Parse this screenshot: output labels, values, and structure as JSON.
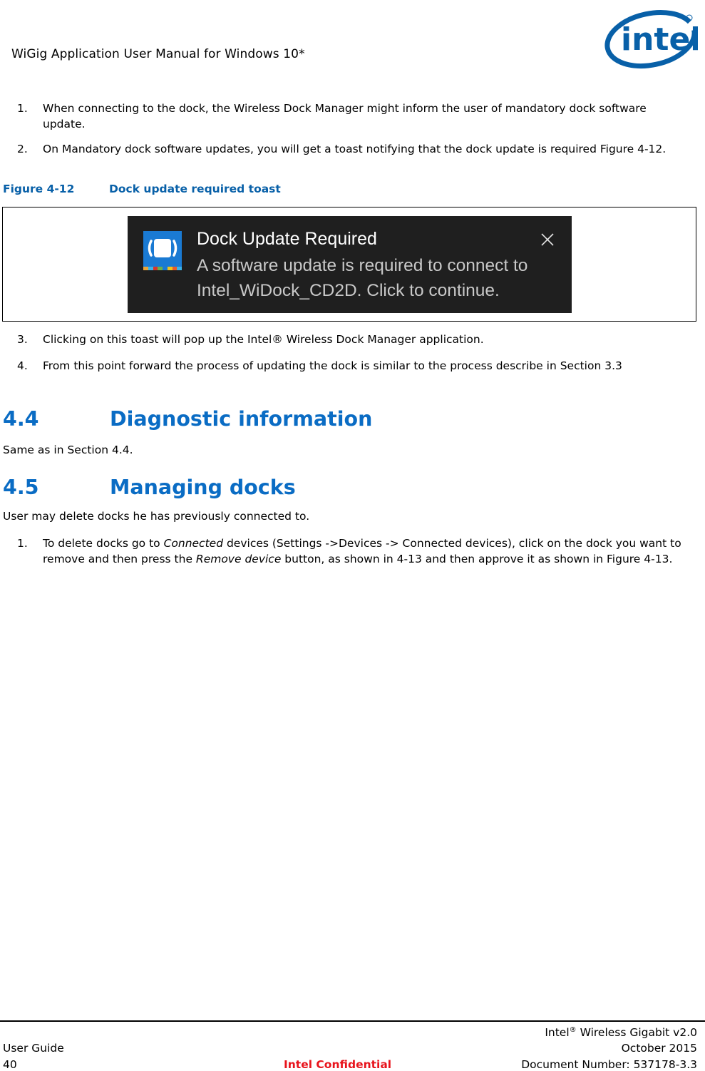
{
  "header": {
    "title": "WiGig Application User Manual for Windows 10*",
    "logo": {
      "icon": "intel-logo",
      "text": "intel",
      "color": "#0860a8"
    }
  },
  "list_a": [
    {
      "num": "1.",
      "text": "When connecting to the dock, the Wireless Dock Manager might inform the user of mandatory dock software update."
    },
    {
      "num": "2.",
      "text": "On Mandatory dock software updates, you will get a toast notifying that the dock update is required Figure 4-12."
    }
  ],
  "figure": {
    "number": "Figure 4-12",
    "caption": "Dock update required toast",
    "toast": {
      "icon": "wireless-dock-icon",
      "title": "Dock Update Required",
      "body": "A software update is required to connect to Intel_WiDock_CD2D. Click to continue.",
      "close_icon": "close-icon",
      "background": "#1f1f1f",
      "icon_color": "#1a7ad3"
    }
  },
  "list_b": [
    {
      "num": "3.",
      "text": "Clicking on this toast will pop up the Intel® Wireless Dock Manager application."
    },
    {
      "num": "4.",
      "text": "From this point forward the process of updating the dock is similar to the process describe in Section 3.3"
    }
  ],
  "sections": [
    {
      "num": "4.4",
      "title": "Diagnostic information",
      "paragraph": "Same as in Section 4.4."
    },
    {
      "num": "4.5",
      "title": "Managing docks",
      "paragraph": "User may delete docks he has previously connected to."
    }
  ],
  "list_c": [
    {
      "num": "1.",
      "parts": [
        {
          "text": "To delete docks go to ",
          "italic": false
        },
        {
          "text": "Connected",
          "italic": true
        },
        {
          "text": " devices (Settings ->Devices -> Connected devices), click on the dock you want to remove and then press the ",
          "italic": false
        },
        {
          "text": "Remove device",
          "italic": true
        },
        {
          "text": " button, as shown in 4-13 and then approve it as shown in Figure 4-13.",
          "italic": false
        }
      ]
    }
  ],
  "footer": {
    "product_prefix": "Intel",
    "product_reg": "®",
    "product_suffix": " Wireless Gigabit v2.0",
    "doc_type": "User Guide",
    "date": "October 2015",
    "page_number": "40",
    "confidential": "Intel Confidential",
    "doc_number": "Document Number: 537178-3.3",
    "confidential_color": "#e8141c"
  },
  "colors": {
    "heading_blue": "#0a6cc4",
    "caption_blue": "#0860a8"
  }
}
